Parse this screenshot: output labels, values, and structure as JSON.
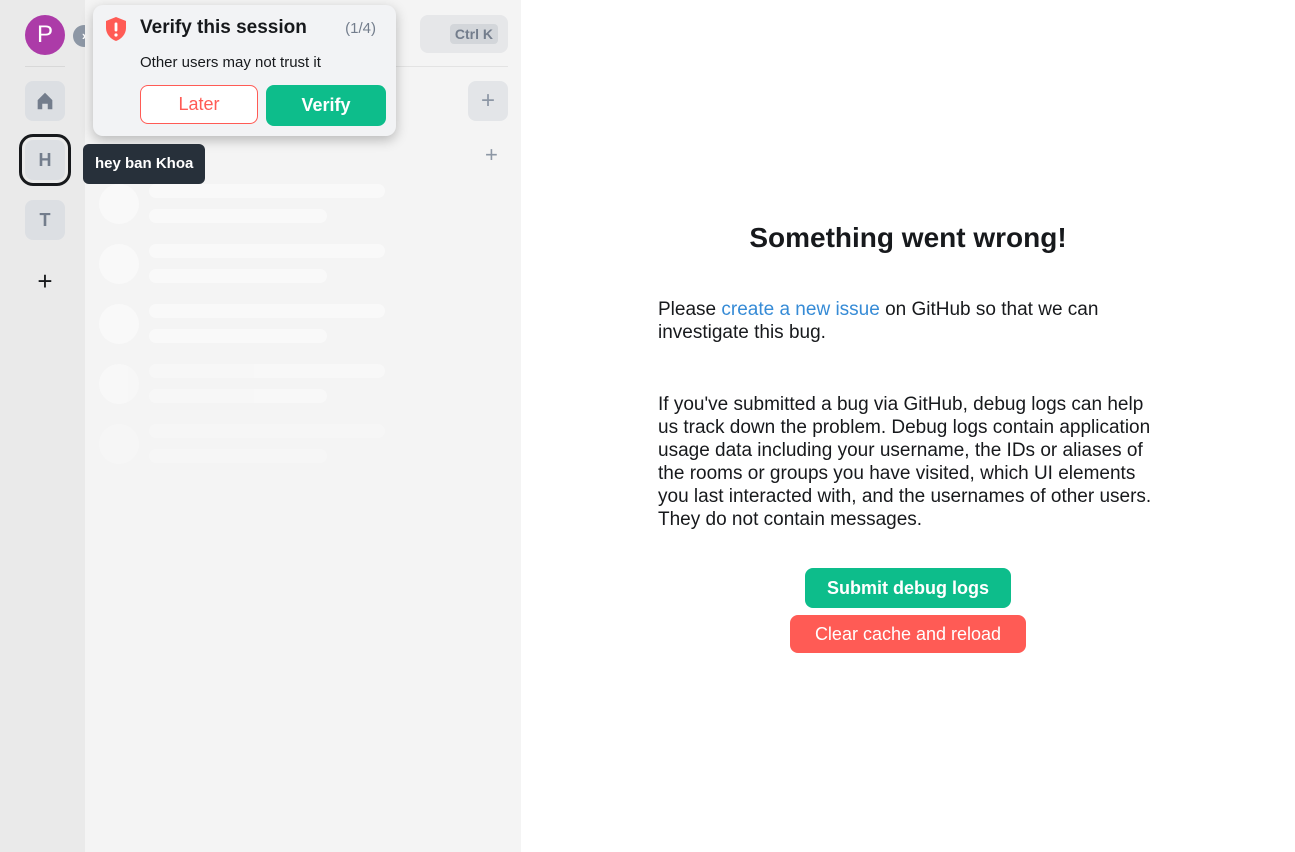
{
  "user": {
    "avatar_letter": "P",
    "avatar_color": "#ac3ba8"
  },
  "spaces": [
    {
      "letter": "H",
      "active": true
    },
    {
      "letter": "T",
      "active": false
    }
  ],
  "search": {
    "shortcut": "Ctrl K"
  },
  "toast": {
    "title": "Verify this session",
    "counter": "(1/4)",
    "body": "Other users may not trust it",
    "later_label": "Later",
    "verify_label": "Verify"
  },
  "tooltip": {
    "text": "hey ban Khoa"
  },
  "error": {
    "title": "Something went wrong!",
    "para1_prefix": "Please ",
    "para1_link": "create a new issue",
    "para1_suffix": " on GitHub so that we can investigate this bug.",
    "para2": "If you've submitted a bug via GitHub, debug logs can help us track down the problem. Debug logs contain application usage data including your username, the IDs or aliases of the rooms or groups you have visited, which UI elements you last interacted with, and the usernames of other users. They do not contain messages.",
    "submit_label": "Submit debug logs",
    "clear_label": "Clear cache and reload"
  },
  "colors": {
    "accent": "#0dbd8b",
    "alert": "#ff5b55",
    "link": "#368bd6"
  }
}
